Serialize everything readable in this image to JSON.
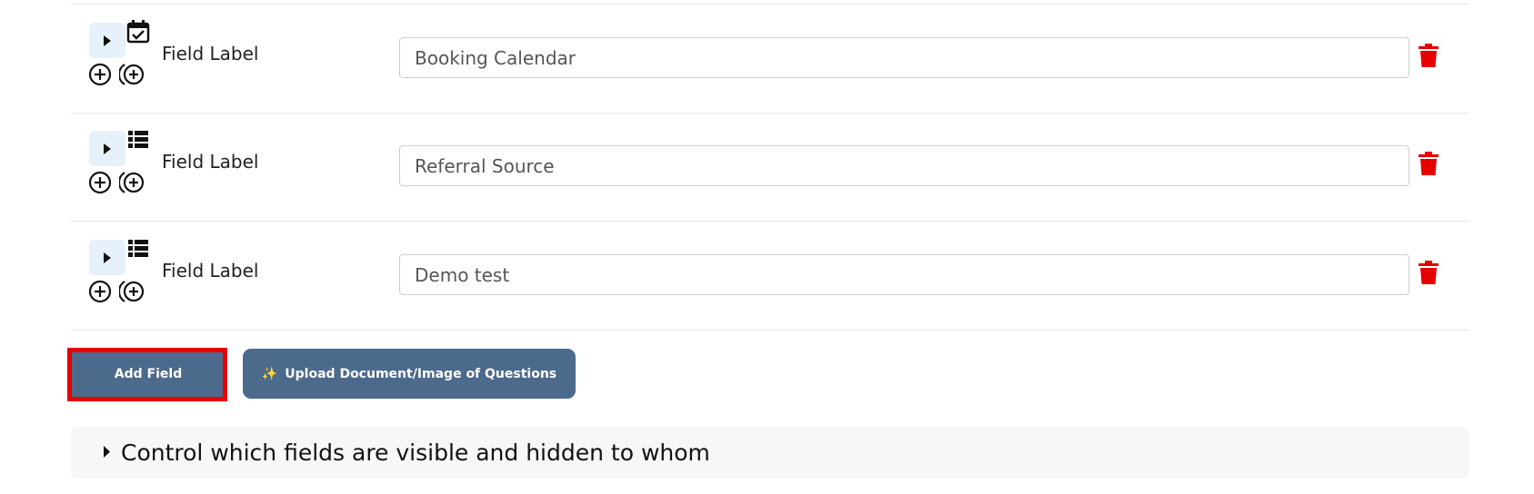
{
  "fields": [
    {
      "label": "Field Label",
      "value": "Booking Calendar",
      "type_icon": "calendar-check-icon"
    },
    {
      "label": "Field Label",
      "value": "Referral Source",
      "type_icon": "list-icon"
    },
    {
      "label": "Field Label",
      "value": "Demo test",
      "type_icon": "list-icon"
    }
  ],
  "buttons": {
    "add_field": "Add Field",
    "upload_sparkle": "✨",
    "upload": "Upload Document/Image of Questions"
  },
  "visibility": {
    "label": "Control which fields are visible and hidden to whom"
  },
  "colors": {
    "button_bg": "#4b6a8c",
    "delete_red": "#e60000",
    "highlight_red": "#e60000"
  }
}
